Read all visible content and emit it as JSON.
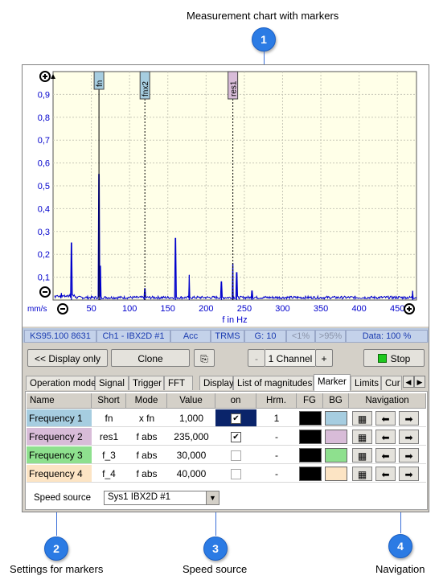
{
  "callouts": {
    "chart": {
      "num": "1",
      "label": "Measurement chart with markers"
    },
    "settings": {
      "num": "2",
      "label": "Settings for markers"
    },
    "speed": {
      "num": "3",
      "label": "Speed source"
    },
    "nav": {
      "num": "4",
      "label": "Navigation"
    }
  },
  "chart_data": {
    "type": "line",
    "xlabel": "f in Hz",
    "ylabel": "mm/s",
    "xlim": [
      0,
      475
    ],
    "ylim": [
      0,
      1.0
    ],
    "x_ticks": [
      "50",
      "100",
      "150",
      "200",
      "250",
      "300",
      "350",
      "400",
      "450"
    ],
    "y_ticks": [
      "0,1",
      "0,2",
      "0,3",
      "0,4",
      "0,5",
      "0,6",
      "0,7",
      "0,8",
      "0,9"
    ],
    "markers": [
      {
        "name": "fn",
        "x": 60
      },
      {
        "name": "fnx2",
        "x": 120
      },
      {
        "name": "res1",
        "x": 235
      }
    ],
    "peaks": [
      {
        "x": 24,
        "y": 0.25
      },
      {
        "x": 60,
        "y": 0.55
      },
      {
        "x": 62,
        "y": 0.15
      },
      {
        "x": 120,
        "y": 0.05
      },
      {
        "x": 160,
        "y": 0.27
      },
      {
        "x": 178,
        "y": 0.11
      },
      {
        "x": 220,
        "y": 0.08
      },
      {
        "x": 235,
        "y": 0.16
      },
      {
        "x": 240,
        "y": 0.12
      },
      {
        "x": 260,
        "y": 0.04
      },
      {
        "x": 470,
        "y": 0.04
      }
    ],
    "colors": {
      "line": "#0000cc",
      "background": "#ffffe8",
      "axis": "#0000cc"
    }
  },
  "status": {
    "device": "KS95.100 8631",
    "channel": "Ch1 - IBX2D #1",
    "mode": "Acc",
    "trms": "TRMS",
    "gain": "G: 10",
    "lt": "<1%",
    "gt": ">95%",
    "data": "Data: 100 %"
  },
  "toolbar": {
    "display_only": "<< Display only",
    "clone": "Clone",
    "minus": "-",
    "channels": "1 Channel",
    "plus": "+",
    "stop": "Stop"
  },
  "tabs": [
    "Operation mode",
    "Signal",
    "Trigger",
    "FFT",
    "Display",
    "List of magnitudes",
    "Marker",
    "Limits",
    "Cur"
  ],
  "table": {
    "headers": [
      "Name",
      "Short",
      "Mode",
      "Value",
      "on",
      "Hrm.",
      "FG",
      "BG",
      "Navigation"
    ],
    "rows": [
      {
        "name": "Frequency 1",
        "short": "fn",
        "mode": "x fn",
        "value": "1,000",
        "on": true,
        "hrm": "1",
        "bg": "#a6cde0",
        "namebg": "#a6cde0"
      },
      {
        "name": "Frequency 2",
        "short": "res1",
        "mode": "f abs",
        "value": "235,000",
        "on": true,
        "hrm": "-",
        "bg": "#d8bcd8",
        "namebg": "#d8bcd8"
      },
      {
        "name": "Frequency 3",
        "short": "f_3",
        "mode": "f abs",
        "value": "30,000",
        "on": false,
        "hrm": "-",
        "bg": "#8ee08e",
        "namebg": "#8ee08e"
      },
      {
        "name": "Frequency 4",
        "short": "f_4",
        "mode": "f abs",
        "value": "40,000",
        "on": false,
        "hrm": "-",
        "bg": "#fce4c4",
        "namebg": "#fce4c4"
      }
    ]
  },
  "speed_source": {
    "label": "Speed source",
    "value": "Sys1 IBX2D #1"
  }
}
